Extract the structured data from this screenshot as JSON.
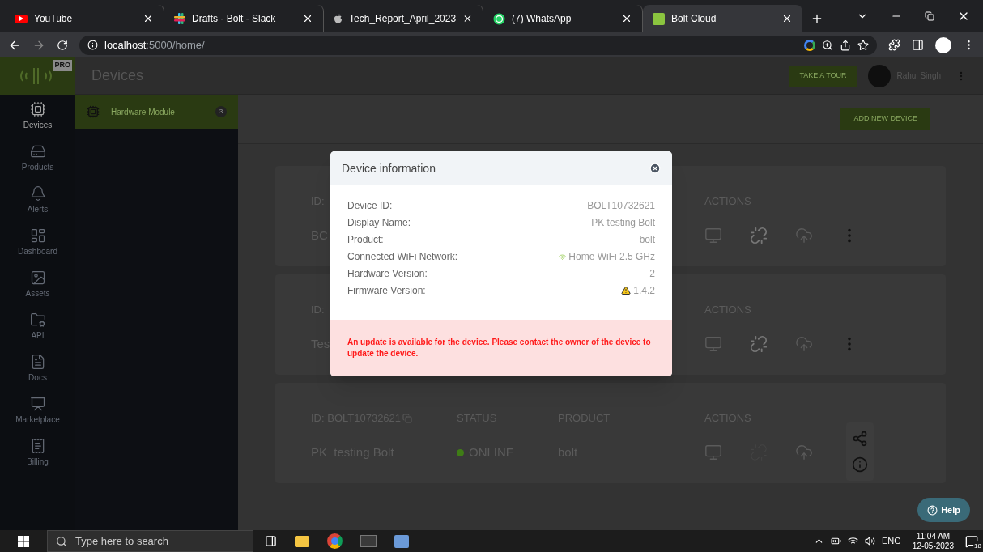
{
  "browser": {
    "tabs": [
      {
        "title": "YouTube",
        "selected": false
      },
      {
        "title": "Drafts - Bolt - Slack",
        "selected": false
      },
      {
        "title": "Tech_Report_April_2023",
        "selected": false
      },
      {
        "title": "(7) WhatsApp",
        "selected": false
      },
      {
        "title": "Bolt Cloud",
        "selected": true
      }
    ],
    "address": {
      "host": "localhost",
      "path": ":5000/home/"
    }
  },
  "app": {
    "logo_badge": "PRO",
    "page_title": "Devices",
    "tour_button": "TAKE A TOUR",
    "user": "Rahul Singh",
    "sidebar": [
      {
        "label": "Devices",
        "selected": true
      },
      {
        "label": "Products",
        "selected": false
      },
      {
        "label": "Alerts",
        "selected": false
      },
      {
        "label": "Dashboard",
        "selected": false
      },
      {
        "label": "Assets",
        "selected": false
      },
      {
        "label": "API",
        "selected": false
      },
      {
        "label": "Docs",
        "selected": false
      },
      {
        "label": "Marketplace",
        "selected": false
      },
      {
        "label": "Billing",
        "selected": false
      }
    ],
    "submenu": [
      {
        "label": "Hardware Module",
        "count": "3",
        "selected": true
      }
    ],
    "add_button": "ADD NEW DEVICE",
    "devices": [
      {
        "id": "ID:",
        "name": "BC",
        "actions_label": "ACTIONS",
        "link_enabled": true,
        "menu": true
      },
      {
        "id": "ID:",
        "name": "Tes",
        "actions_label": "ACTIONS",
        "link_enabled": true,
        "menu": true
      },
      {
        "id": "ID: BOLT10732621",
        "status_label": "STATUS",
        "product_label": "PRODUCT",
        "actions_label": "ACTIONS",
        "name": "PK  testing Bolt",
        "status": "ONLINE",
        "product": "bolt",
        "link_enabled": false,
        "menu": false
      }
    ],
    "help": "Help"
  },
  "modal": {
    "title": "Device information",
    "fields": [
      {
        "label": "Device ID:",
        "value": "BOLT10732621",
        "kind": "plain"
      },
      {
        "label": "Display Name:",
        "value": "PK testing Bolt",
        "kind": "plain"
      },
      {
        "label": "Product:",
        "value": "bolt",
        "kind": "plain"
      },
      {
        "label": "Connected WiFi Network:",
        "value": "Home WiFi 2.5 GHz",
        "kind": "wifi"
      },
      {
        "label": "Hardware Version:",
        "value": "2",
        "kind": "plain"
      },
      {
        "label": "Firmware Version:",
        "value": "1.4.2",
        "kind": "warning"
      }
    ],
    "alert": "An update is available for the device. Please contact the owner of the device to update the device."
  },
  "taskbar": {
    "search_placeholder": "Type here to search",
    "language": "ENG",
    "time": "11:04 AM",
    "date": "12-05-2023",
    "notifications": "18"
  }
}
